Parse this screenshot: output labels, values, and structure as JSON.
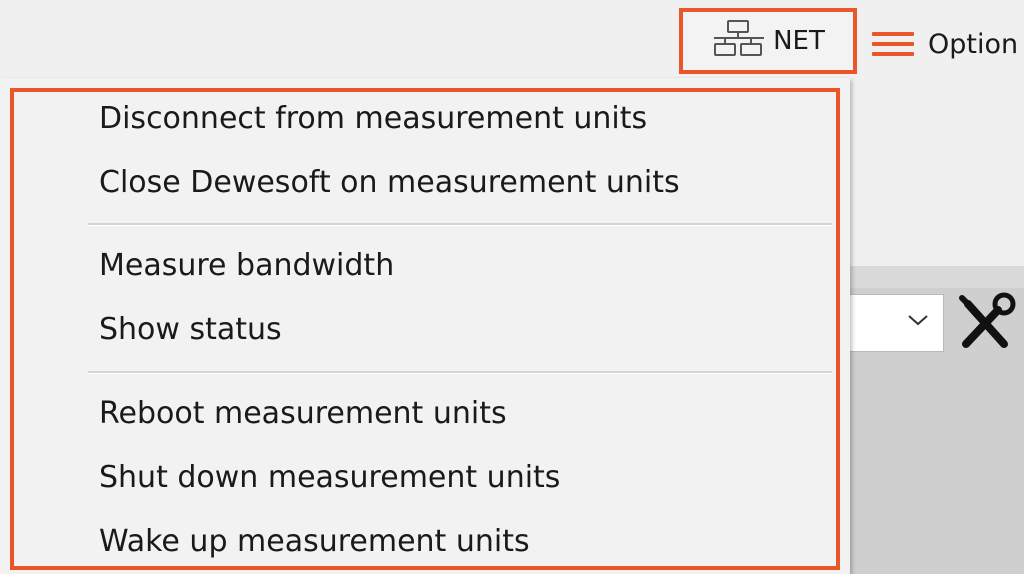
{
  "toolbar": {
    "net_label": "NET",
    "net_icon": "network-icon",
    "options_label": "Option",
    "options_icon": "hamburger-menu-icon",
    "accent_color": "#e8562a"
  },
  "menu": {
    "groups": [
      {
        "items": [
          {
            "label": "Disconnect from measurement units"
          },
          {
            "label": "Close Dewesoft on measurement units"
          }
        ]
      },
      {
        "items": [
          {
            "label": "Measure bandwidth"
          },
          {
            "label": "Show status"
          }
        ]
      },
      {
        "items": [
          {
            "label": "Reboot measurement units"
          },
          {
            "label": "Shut down measurement units"
          },
          {
            "label": "Wake up measurement units"
          }
        ]
      }
    ]
  },
  "side": {
    "combo_icon": "chevron-down-icon",
    "tools_icon": "tools-icon"
  }
}
